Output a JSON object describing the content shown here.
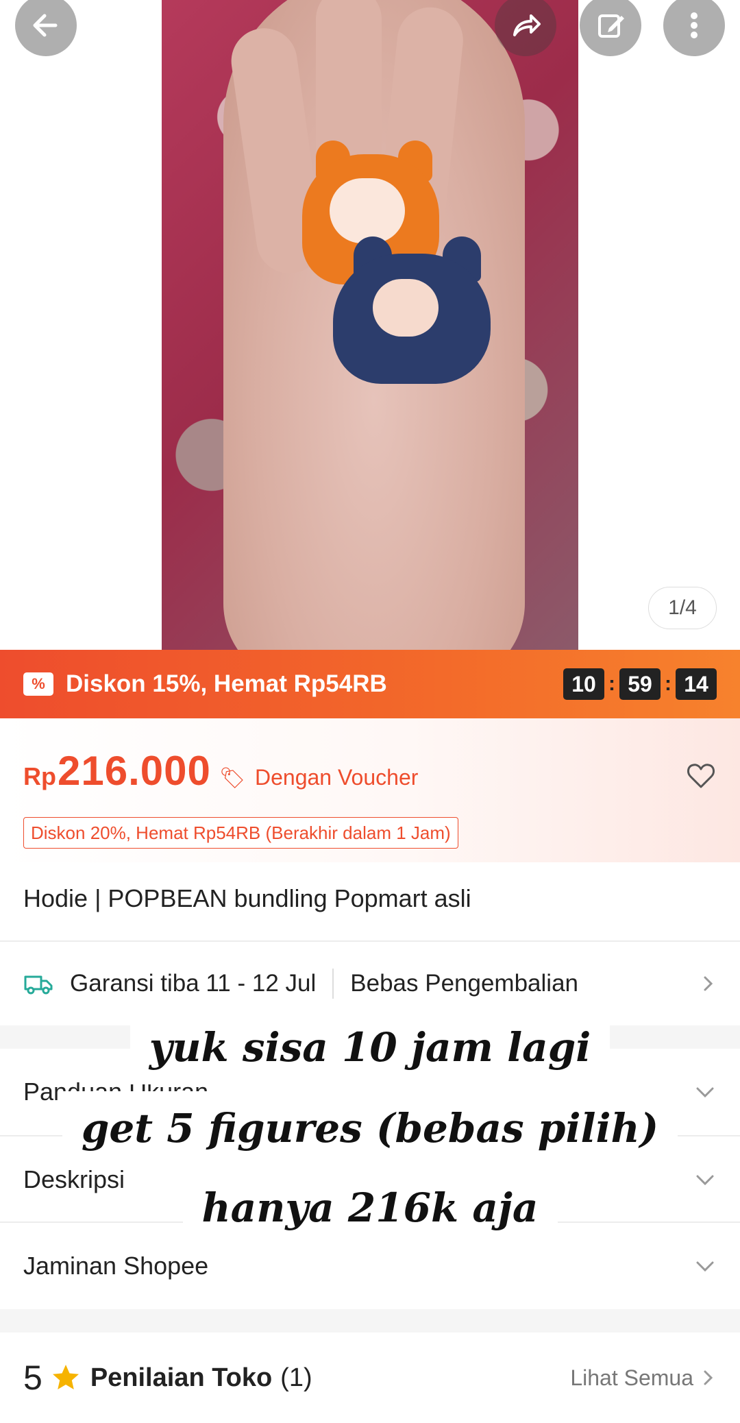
{
  "top_actions": {
    "back_icon": "arrow-left-icon",
    "share_icon": "share-icon",
    "edit_icon": "edit-icon",
    "more_icon": "more-vertical-icon"
  },
  "gallery": {
    "pager": "1/4"
  },
  "flash_sale": {
    "text": "Diskon 15%, Hemat Rp54RB",
    "timer": {
      "hours": "10",
      "minutes": "59",
      "seconds": "14"
    }
  },
  "price": {
    "currency": "Rp",
    "amount": "216.000",
    "voucher_label": "Dengan Voucher",
    "discount_tag": "Diskon 20%, Hemat Rp54RB (Berakhir dalam 1 Jam)"
  },
  "product": {
    "title": "Hodie | POPBEAN bundling Popmart asli"
  },
  "shipping": {
    "guarantee": "Garansi tiba 11 - 12 Jul",
    "returns": "Bebas Pengembalian"
  },
  "sections": [
    {
      "label": "Panduan Ukuran"
    },
    {
      "label": "Deskripsi"
    },
    {
      "label": "Jaminan Shopee"
    }
  ],
  "rating": {
    "score": "5",
    "label": "Penilaian Toko",
    "count": "(1)",
    "see_all": "Lihat Semua"
  },
  "overlay_caption": [
    "yuk sisa 10 jam lagi",
    "get 5 figures (bebas pilih)",
    "hanya 216k aja"
  ],
  "colors": {
    "brand": "#ee4d2d",
    "flash_gradient_end": "#f7822d",
    "star": "#f6b300"
  }
}
